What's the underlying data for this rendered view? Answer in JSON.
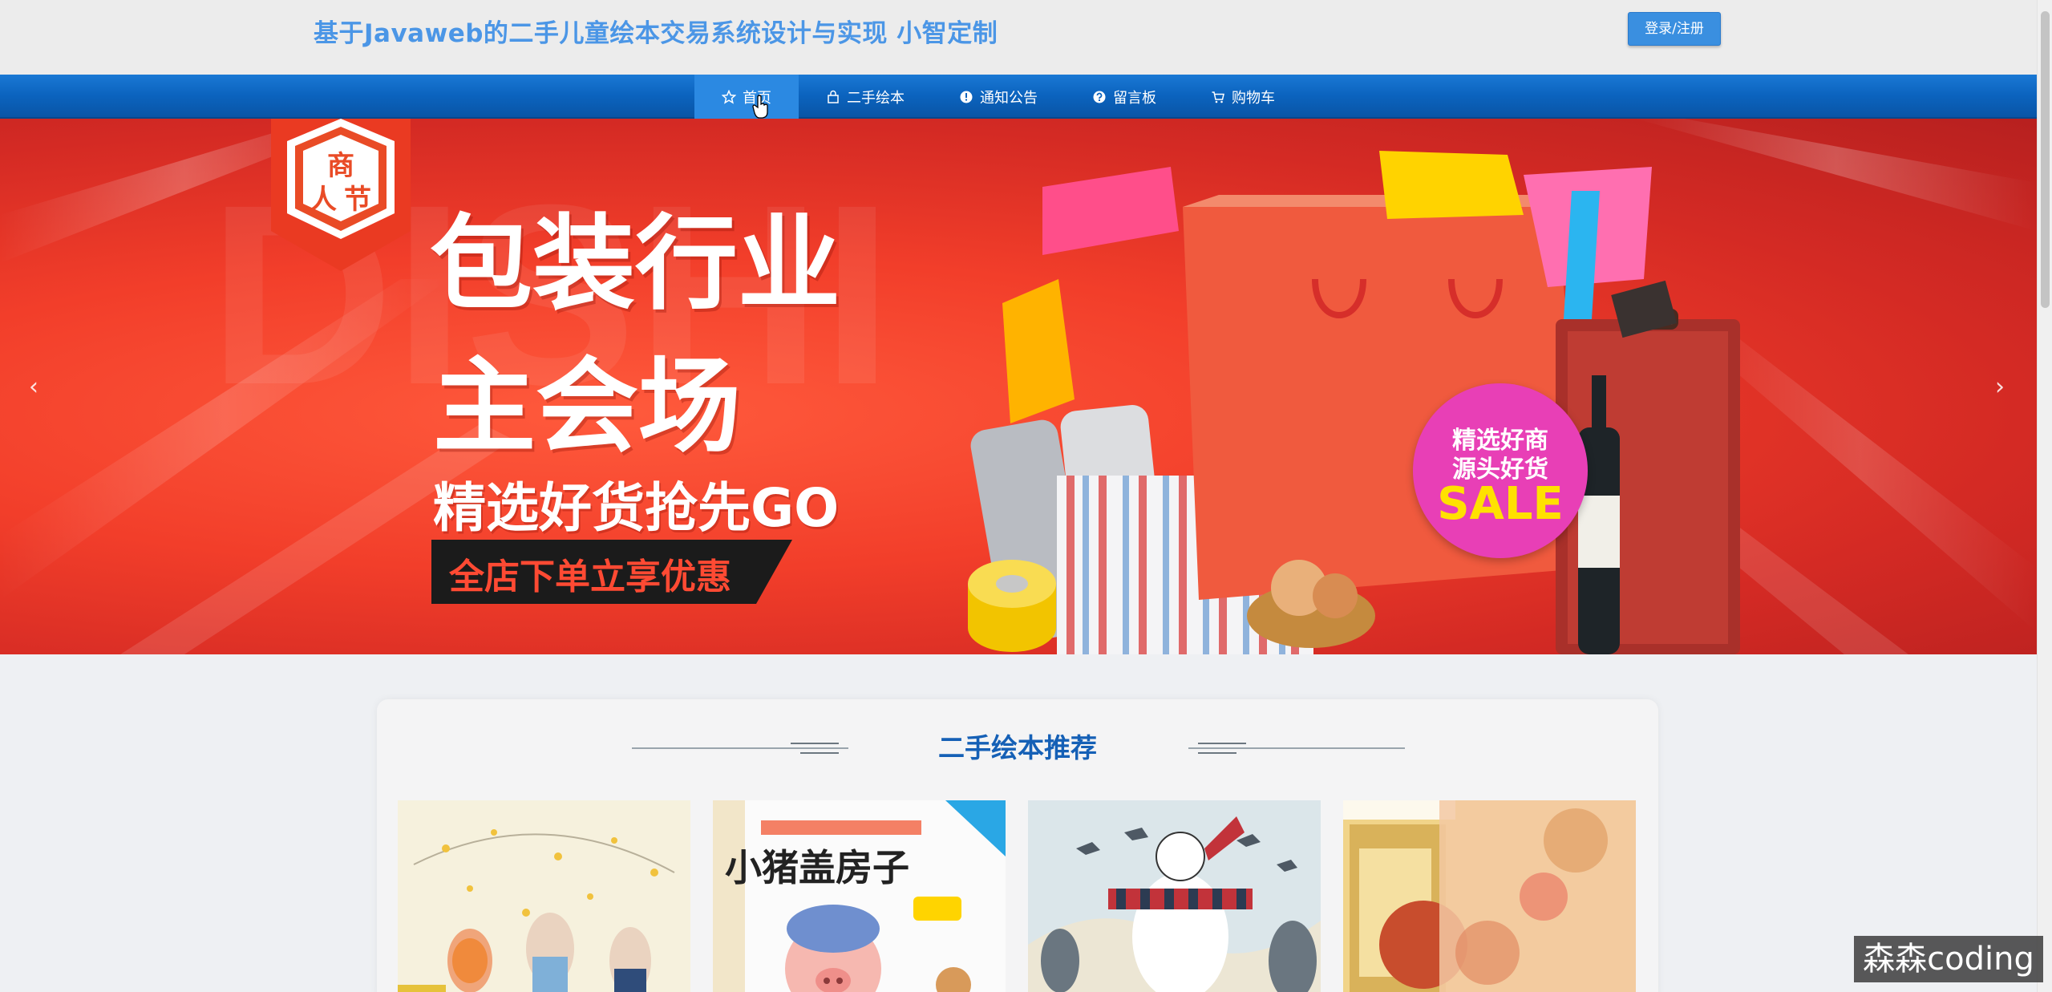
{
  "header": {
    "site_title": "基于Javaweb的二手儿童绘本交易系统设计与实现 小智定制",
    "login_button": "登录/注册"
  },
  "nav": {
    "items": [
      {
        "label": "首页",
        "icon": "star-icon",
        "active": true
      },
      {
        "label": "二手绘本",
        "icon": "bag-icon",
        "active": false
      },
      {
        "label": "通知公告",
        "icon": "info-icon",
        "active": false
      },
      {
        "label": "留言板",
        "icon": "question-icon",
        "active": false
      },
      {
        "label": "购物车",
        "icon": "cart-icon",
        "active": false
      }
    ]
  },
  "banner": {
    "badge_text": "商人节",
    "headline_line1": "包装行业",
    "headline_line2": "主会场",
    "tagline": "精选好货抢先GO",
    "promo": "全店下单立享优惠",
    "sale_line1": "精选好商",
    "sale_line2": "源头好货",
    "sale_word": "SALE",
    "prev_icon": "chevron-left-icon",
    "next_icon": "chevron-right-icon",
    "accent_color": "#f23e2a"
  },
  "section": {
    "title": "二手绘本推荐",
    "books": [
      {
        "name": "book-1",
        "title": ""
      },
      {
        "name": "book-2",
        "title": "小猪盖房子"
      },
      {
        "name": "book-3",
        "title": ""
      },
      {
        "name": "book-4",
        "title": ""
      }
    ]
  },
  "watermark": "森森coding"
}
